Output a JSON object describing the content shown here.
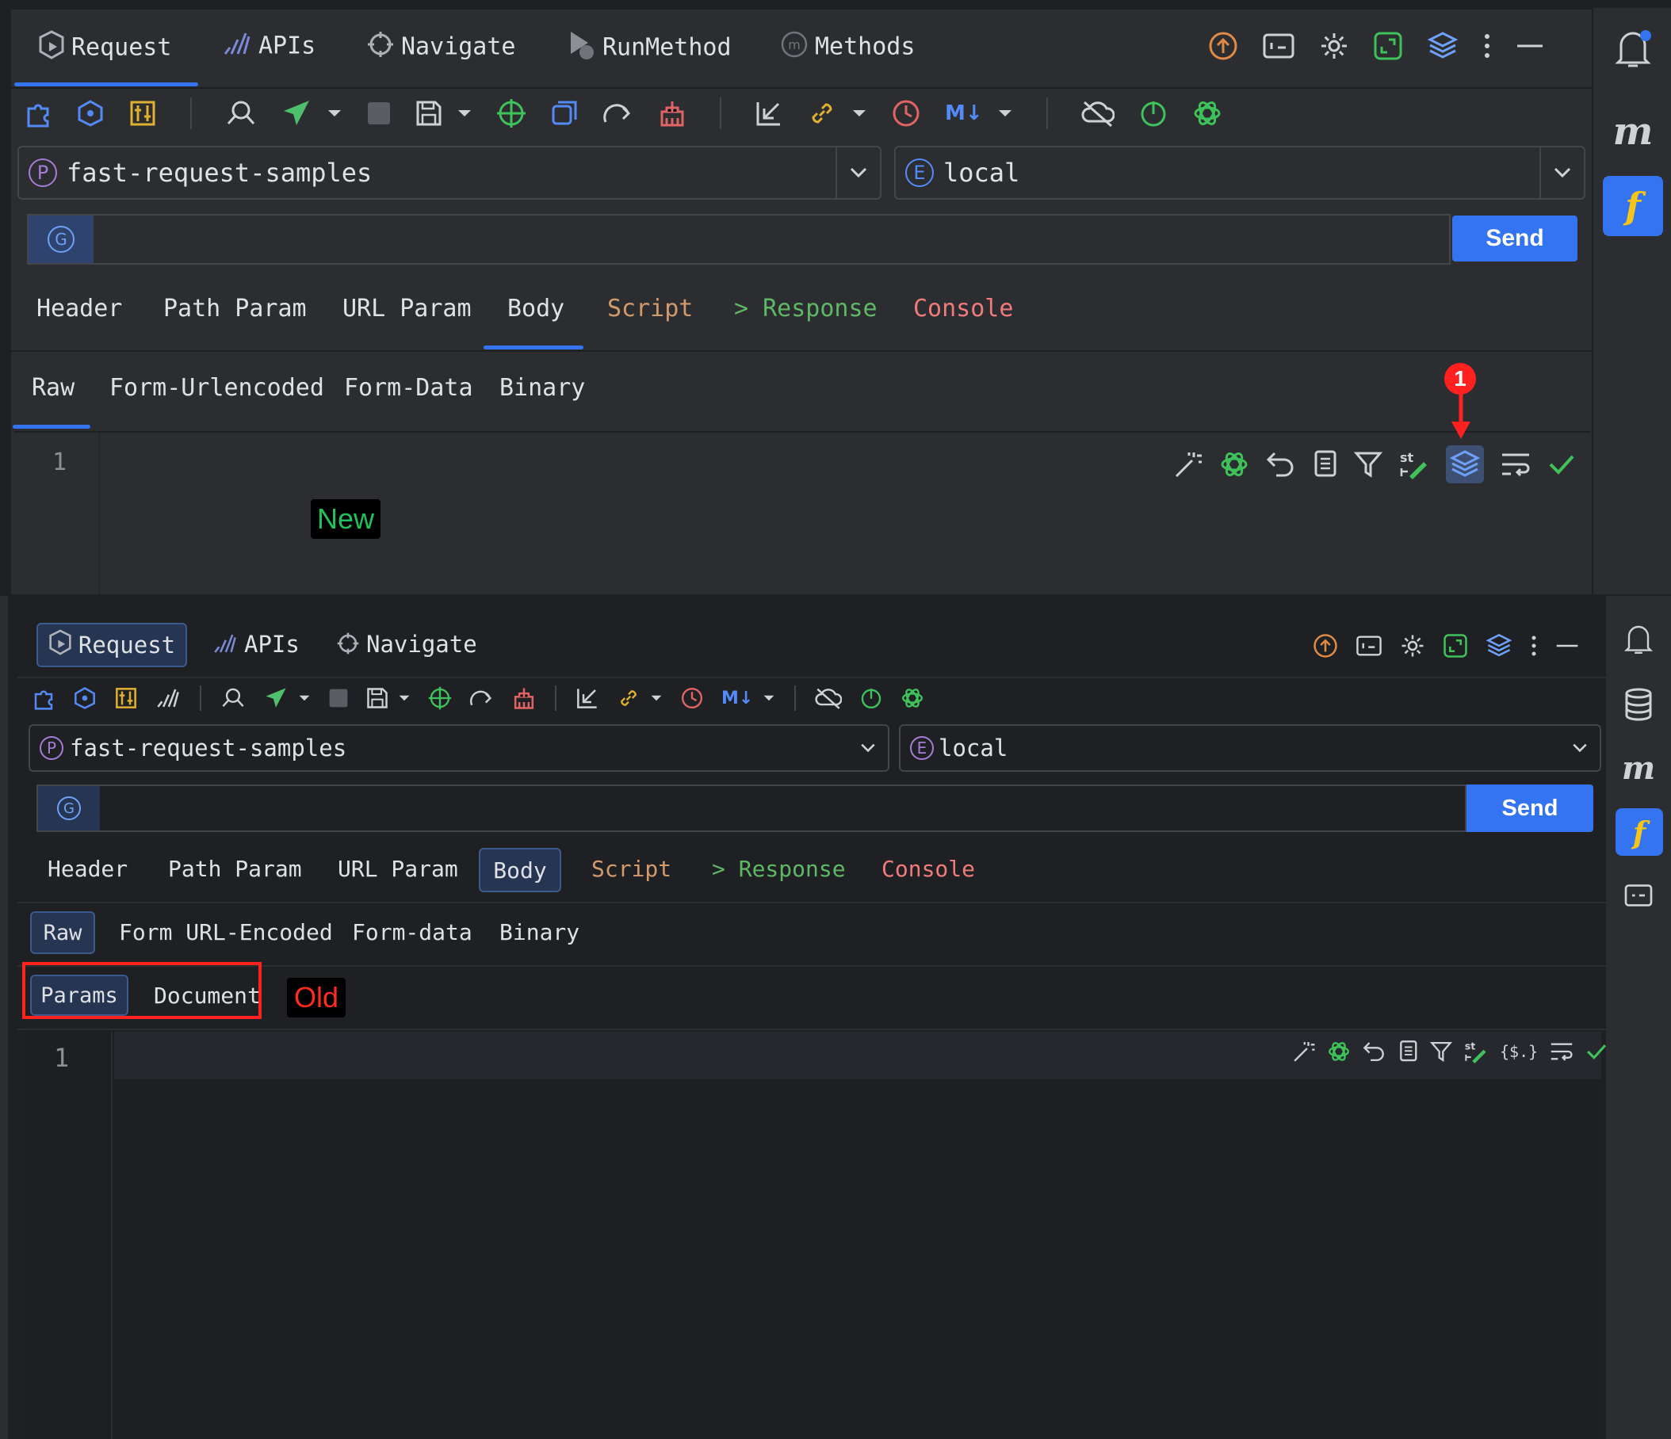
{
  "top_panel": {
    "main_tabs": [
      {
        "label": "Request",
        "icon": "request-icon"
      },
      {
        "label": "APIs",
        "icon": "apis-icon"
      },
      {
        "label": "Navigate",
        "icon": "crosshair-icon"
      },
      {
        "label": "RunMethod",
        "icon": "run-method-icon"
      },
      {
        "label": "Methods",
        "icon": "methods-icon"
      }
    ],
    "project_select": {
      "badge": "P",
      "value": "fast-request-samples"
    },
    "env_select": {
      "badge": "E",
      "value": "local"
    },
    "url_input": {
      "badge": "G",
      "value": ""
    },
    "send_label": "Send",
    "request_tabs": [
      "Header",
      "Path Param",
      "URL Param",
      "Body",
      "Script",
      "> Response",
      "Console"
    ],
    "body_tabs": [
      "Raw",
      "Form-Urlencoded",
      "Form-Data",
      "Binary"
    ],
    "line_number": "1",
    "annotation_marker": "1",
    "label": "New"
  },
  "bottom_panel": {
    "main_tabs": [
      {
        "label": "Request",
        "icon": "request-icon"
      },
      {
        "label": "APIs",
        "icon": "apis-icon"
      },
      {
        "label": "Navigate",
        "icon": "crosshair-icon"
      }
    ],
    "project_select": {
      "badge": "P",
      "value": "fast-request-samples"
    },
    "env_select": {
      "badge": "E",
      "value": "local"
    },
    "url_input": {
      "badge": "G",
      "value": ""
    },
    "send_label": "Send",
    "request_tabs": [
      "Header",
      "Path Param",
      "URL Param",
      "Body",
      "Script",
      "> Response",
      "Console"
    ],
    "body_tabs": [
      "Raw",
      "Form URL-Encoded",
      "Form-data",
      "Binary"
    ],
    "sub_tabs": [
      "Params",
      "Document"
    ],
    "line_number": "1",
    "label": "Old",
    "editor_json_path_label": "{$.}"
  },
  "colors": {
    "accent": "#3574f0",
    "script": "#d39a6b",
    "response": "#5fb865",
    "console": "#f17b7b",
    "new_label": "#21c15e",
    "old_label": "#ff2b1d",
    "annotation_red": "#ff2020"
  }
}
